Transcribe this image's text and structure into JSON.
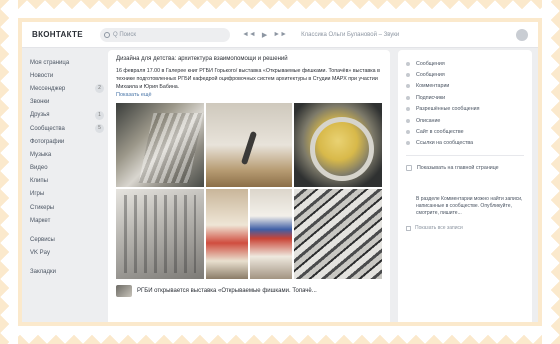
{
  "header": {
    "logo": "ВКОНТАКТЕ",
    "search_placeholder": "Q  Поиск",
    "player": [
      "◄◄",
      "▶",
      "►►"
    ],
    "track": "Классика Ольги Булановой – Звуки"
  },
  "sidebar": {
    "items": [
      {
        "label": "Моя страница",
        "count": ""
      },
      {
        "label": "Новости",
        "count": ""
      },
      {
        "label": "Мессенджер",
        "count": "2"
      },
      {
        "label": "Звонки",
        "count": ""
      },
      {
        "label": "Друзья",
        "count": "1"
      },
      {
        "label": "Сообщества",
        "count": "5"
      },
      {
        "label": "Фотографии",
        "count": ""
      },
      {
        "label": "Музыка",
        "count": ""
      },
      {
        "label": "Видео",
        "count": ""
      },
      {
        "label": "Клипы",
        "count": ""
      },
      {
        "label": "Игры",
        "count": ""
      },
      {
        "label": "Стикеры",
        "count": ""
      },
      {
        "label": "Маркет",
        "count": ""
      }
    ],
    "secondary": [
      {
        "label": "Сервисы"
      },
      {
        "label": "VK Pay"
      },
      {
        "label": "Закладки"
      }
    ]
  },
  "post": {
    "head": "Дизайна для детства: архитектура взаимопомощи и решений",
    "text": "16 февраля 17.00 в Галерее книг РГБИ Горького/ выставка «Открываемые фишками. Топачёв» выставка в технике подготовленных РГБИ кафедрой оцифровочных систем архитектуры в Студии МАРХ при участии Михаила и Юрия Бабина.",
    "more": "Показать ещё",
    "repost_title": "РГБИ открывается выставка «Открываемые фишками. Топачё..."
  },
  "right_panel": {
    "items": [
      "Сообщения",
      "Сообщения",
      "Комментарии",
      "Подписчики",
      "Разрешённые сообщения",
      "Описание",
      "Сайт в сообществе",
      "Ссылки на сообщества"
    ],
    "checkbox_label": "Показывать на главной странице",
    "note": "В разделе Комментарии можно найти записи, написанные в сообществе. Опубликуйте, смотрите, пишите...",
    "footer": "Показать все записи"
  }
}
